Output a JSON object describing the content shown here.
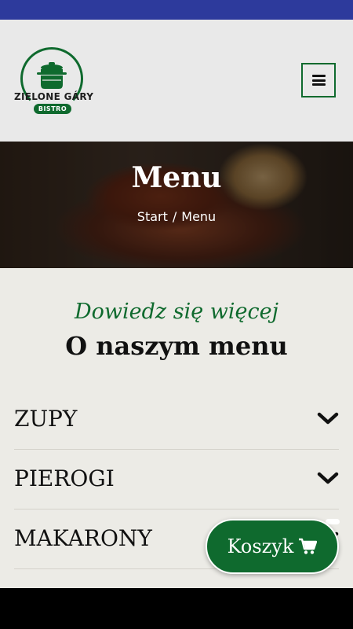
{
  "header": {
    "logo": {
      "name": "ZIELONE GÁRY",
      "badge": "BISTRO"
    },
    "menu_toggle_icon": "hamburger-icon"
  },
  "hero": {
    "title": "Menu",
    "breadcrumb": {
      "home": "Start",
      "separator": "/",
      "current": "Menu"
    }
  },
  "section": {
    "eyebrow": "Dowiedz się więcej",
    "title": "O naszym menu"
  },
  "accordion": [
    {
      "label": "ZUPY",
      "icon": "chevron-down-icon"
    },
    {
      "label": "PIEROGI",
      "icon": "chevron-down-icon"
    },
    {
      "label": "MAKARONY",
      "icon": "chevron-down-icon"
    }
  ],
  "cart": {
    "label": "Koszyk",
    "icon": "cart-icon"
  },
  "colors": {
    "brand_green": "#0f6a2e",
    "status_bar": "#2d3a9c",
    "background": "#ecebe6"
  }
}
